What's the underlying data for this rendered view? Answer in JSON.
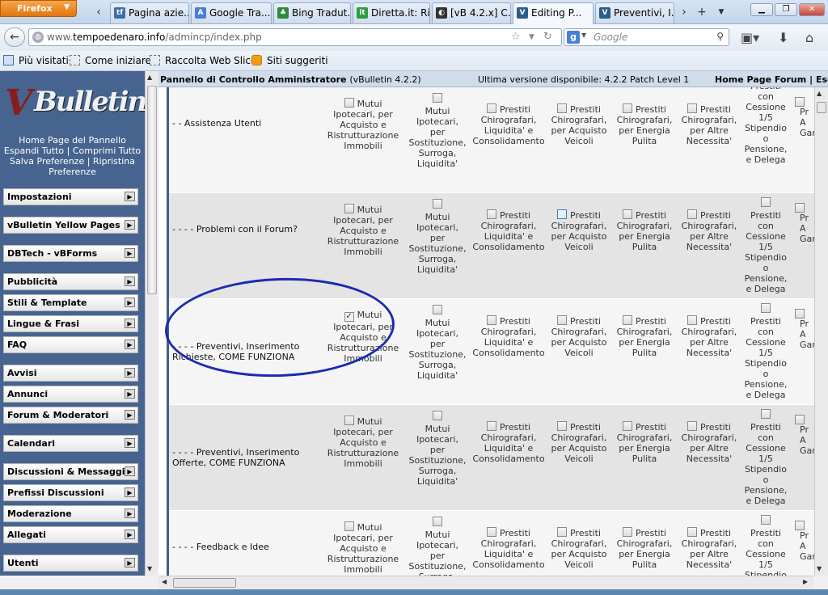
{
  "browser": {
    "app_button": "Firefox",
    "tabs": [
      {
        "label": "Pagina azie...",
        "favicon": "tf",
        "color": "#3b6ea8"
      },
      {
        "label": "Google Tra...",
        "favicon": "A",
        "color": "#4a7fd8"
      },
      {
        "label": "Bing Tradut...",
        "favicon": "♣",
        "color": "#2f8a3b"
      },
      {
        "label": "Diretta.it: Ri...",
        "favicon": "it",
        "color": "#2d9e3c"
      },
      {
        "label": "[vB 4.2.x] C...",
        "favicon": "◐",
        "color": "#333333"
      },
      {
        "label": "Editing P...",
        "favicon": "V",
        "color": "#2b5c8a",
        "active": true
      },
      {
        "label": "Preventivi, I...",
        "favicon": "V",
        "color": "#2b5c8a"
      }
    ],
    "url_prefix": "www.",
    "url_domain": "tempoedenaro.info",
    "url_path": "/admincp/index.php",
    "search_placeholder": "Google",
    "search_engine_icon": "g-icon",
    "bookmarks": [
      "Più visitati",
      "Come iniziare",
      "Raccolta Web Slice",
      "Siti suggeriti"
    ]
  },
  "sidebar": {
    "links": [
      "Home Page del Pannello",
      "Espandi Tutto",
      "Comprimi Tutto",
      "Salva Preferenze",
      "Ripristina",
      "Preferenze"
    ],
    "groups": [
      "Impostazioni",
      "vBulletin Yellow Pages",
      "DBTech - vBForms",
      "Pubblicità",
      "Stili & Template",
      "Lingue & Frasi",
      "FAQ",
      "Avvisi",
      "Annunci",
      "Forum & Moderatori",
      "Calendari",
      "Discussioni & Messaggi",
      "Prefissi Discussioni",
      "Moderazione",
      "Allegati",
      "Utenti"
    ]
  },
  "header": {
    "title": "Pannello di Controllo Amministratore",
    "version": "(vBulletin 4.2.2)",
    "latest": "Ultima versione disponibile: 4.2.2 Patch Level 1",
    "home_link": "Home Page Forum",
    "separator": "|",
    "exit_link": "Esci"
  },
  "option_labels": {
    "mutui_acq": [
      "Mutui",
      "Ipotecari, per",
      "Acquisto e",
      "Ristrutturazione",
      "Immobili"
    ],
    "mutui_sost": [
      "Mutui",
      "Ipotecari,",
      "per",
      "Sostituzione,",
      "Surroga,",
      "Liquidita'"
    ],
    "prestiti_cons": [
      "Prestiti",
      "Chirografari,",
      "Liquidita' e",
      "Consolidamento"
    ],
    "prestiti_veic": [
      "Prestiti",
      "Chirografari,",
      "per Acquisto",
      "Veicoli"
    ],
    "prestiti_energ": [
      "Prestiti",
      "Chirografari,",
      "per Energia",
      "Pulita"
    ],
    "prestiti_altre": [
      "Prestiti",
      "Chirografari,",
      "per Altre",
      "Necessita'"
    ],
    "cessione": [
      "Prestiti",
      "con",
      "Cessione",
      "1/5",
      "Stipendio",
      "o",
      "Pensione,",
      "e Delega"
    ],
    "cut_col": [
      "Pr",
      "A",
      "Gar"
    ]
  },
  "rows": [
    {
      "label": "- - Assistenza Utenti",
      "checked": "none",
      "hover": "none"
    },
    {
      "label": "- - - - Problemi con il Forum?",
      "checked": "none",
      "hover": "prestiti_veic"
    },
    {
      "label": "- - - - Preventivi, Inserimento Richieste, COME FUNZIONA",
      "checked": "mutui_acq",
      "hover": "none",
      "circled": true
    },
    {
      "label": "- - - - Preventivi, Inserimento Offerte, COME FUNZIONA",
      "checked": "none",
      "hover": "none"
    },
    {
      "label": "- - - - Feedback e Idee",
      "checked": "none",
      "hover": "none"
    }
  ]
}
